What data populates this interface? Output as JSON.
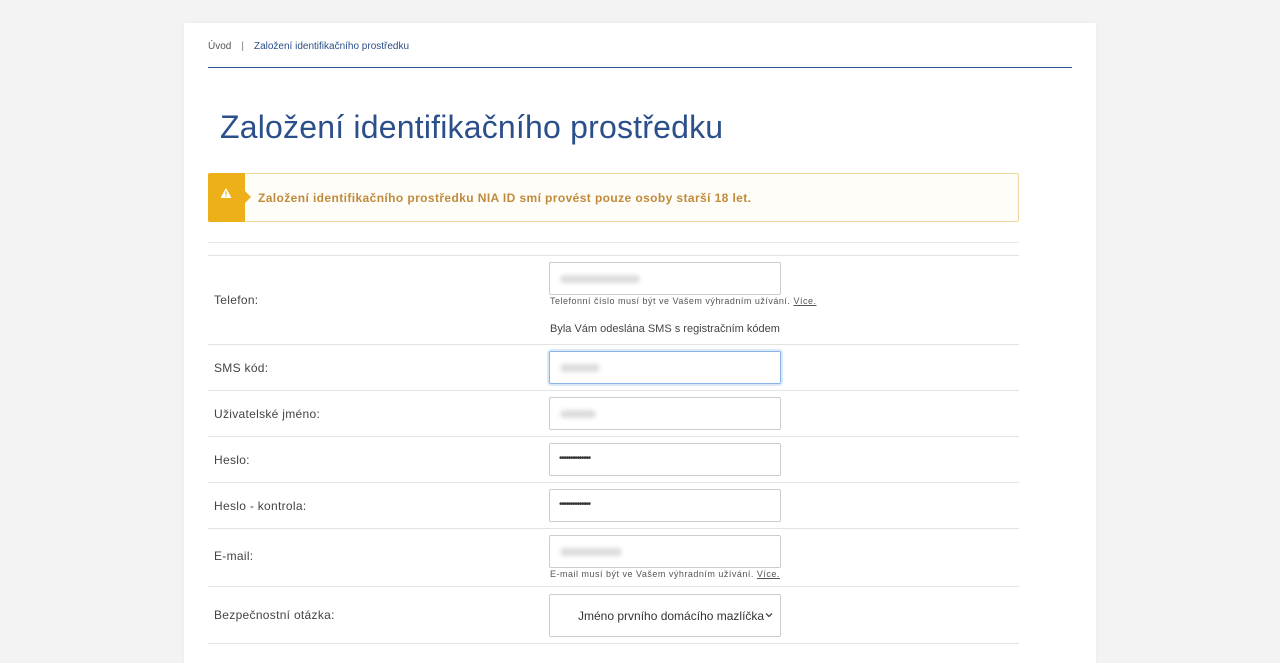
{
  "breadcrumb": {
    "home": "Úvod",
    "separator": "|",
    "current": "Založení identifikačního prostředku"
  },
  "page": {
    "title": "Založení identifikačního prostředku"
  },
  "alert": {
    "icon": "warning-triangle-icon",
    "text": "Založení identifikačního prostředku NIA ID smí provést pouze osoby starší 18 let.",
    "color": "#eeb018"
  },
  "form": {
    "phone": {
      "label": "Telefon:",
      "hint": "Telefonní číslo musí být ve Vašem výhradním užívání.",
      "hint_link": "Více.",
      "sms_note": "Byla Vám odeslána SMS s registračním kódem"
    },
    "sms_code": {
      "label": "SMS kód:"
    },
    "username": {
      "label": "Uživatelské jméno:"
    },
    "password": {
      "label": "Heslo:",
      "value": "••••••••••••••"
    },
    "password_check": {
      "label": "Heslo - kontrola:",
      "value": "••••••••••••••"
    },
    "email": {
      "label": "E-mail:",
      "hint": "E-mail musí být ve Vašem výhradním užívání.",
      "hint_link": "Více."
    },
    "security_question": {
      "label": "Bezpečnostní otázka:",
      "selected": "Jméno prvního domácího mazlíčka"
    }
  },
  "colors": {
    "brand": "#2b4f8a",
    "warning": "#eeb018",
    "warning_text": "#c08a3a"
  }
}
